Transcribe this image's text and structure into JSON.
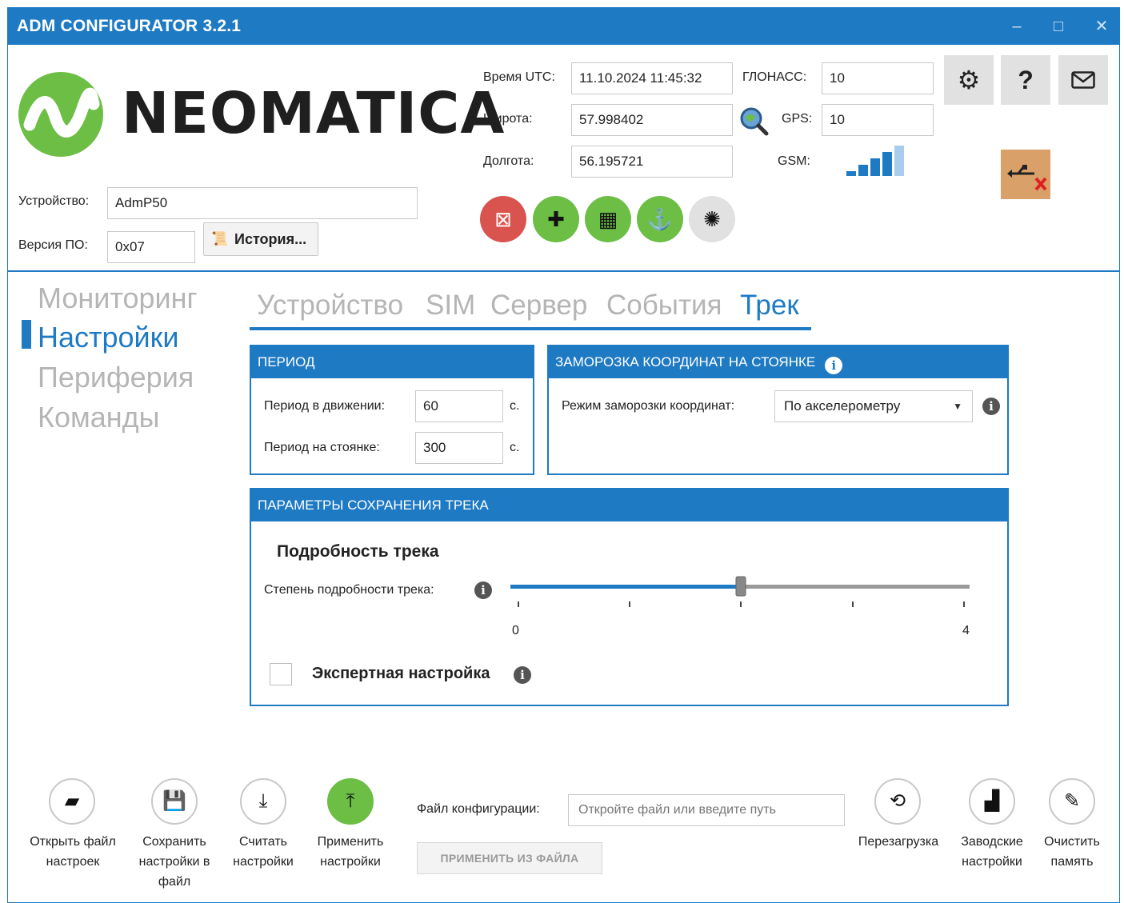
{
  "window": {
    "title": "ADM CONFIGURATOR 3.2.1",
    "controls": [
      "‒",
      "□",
      "✕"
    ]
  },
  "logo": {
    "text": "NEOMATICA"
  },
  "device": {
    "device_label": "Устройство:",
    "device_value": "AdmP50",
    "firmware_label": "Версия ПО:",
    "firmware_value": "0x07",
    "history_button": "История..."
  },
  "status": {
    "utc_label": "Время UTC:",
    "utc_value": "11.10.2024 11:45:32",
    "lat_label": "Широта:",
    "lat_value": "57.998402",
    "lon_label": "Долгота:",
    "lon_value": "56.195721",
    "glonass_label": "ГЛОНАСС:",
    "glonass_value": "10",
    "gps_label": "GPS:",
    "gps_value": "10",
    "gsm_label": "GSM:",
    "gsm_level": 4
  },
  "status_icons": [
    {
      "name": "no-connection-icon",
      "color": "#d9534f",
      "glyph": "⊠"
    },
    {
      "name": "power-plug-icon",
      "color": "#6cbe45",
      "glyph": "✚"
    },
    {
      "name": "map-icon",
      "color": "#6cbe45",
      "glyph": "▦"
    },
    {
      "name": "anchor-icon",
      "color": "#6cbe45",
      "glyph": "⚓"
    },
    {
      "name": "alarm-light-icon",
      "color": "#e1e1e1",
      "glyph": "✺"
    }
  ],
  "sidebar": {
    "items": [
      "Мониторинг",
      "Настройки",
      "Периферия",
      "Команды"
    ],
    "active": "Настройки"
  },
  "tabs": {
    "items": [
      "Устройство",
      "SIM",
      "Сервер",
      "События",
      "Трек"
    ],
    "active": "Трек"
  },
  "period": {
    "title": "ПЕРИОД",
    "moving_label": "Период в движении:",
    "moving_value": "60",
    "moving_unit": "с.",
    "parking_label": "Период на стоянке:",
    "parking_value": "300",
    "parking_unit": "с."
  },
  "freeze": {
    "title": "ЗАМОРОЗКА КООРДИНАТ НА СТОЯНКЕ",
    "mode_label": "Режим заморозки координат:",
    "mode_value": "По акселерометру"
  },
  "track": {
    "title": "ПАРАМЕТРЫ СОХРАНЕНИЯ ТРЕКА",
    "subtitle": "Подробность трека",
    "detail_label": "Степень подробности трека:",
    "slider_min": "0",
    "slider_max": "4",
    "slider_value": 2,
    "expert_label": "Экспертная настройка",
    "expert_checked": false
  },
  "footer": {
    "open_label_1": "Открыть файл",
    "open_label_2": "настроек",
    "save_label_1": "Сохранить",
    "save_label_2": "настройки в",
    "save_label_3": "файл",
    "read_label_1": "Считать",
    "read_label_2": "настройки",
    "apply_label_1": "Применить",
    "apply_label_2": "настройки",
    "config_file_label": "Файл конфигурации:",
    "config_file_placeholder": "Откройте файл или введите путь",
    "apply_from_file": "ПРИМЕНИТЬ ИЗ ФАЙЛА",
    "reboot_label": "Перезагрузка",
    "factory_label_1": "Заводские",
    "factory_label_2": "настройки",
    "clear_label_1": "Очистить",
    "clear_label_2": "память"
  },
  "colors": {
    "accent": "#1f7ac4",
    "green": "#6cbe45",
    "red": "#d9534f",
    "usb": "#d9a06a"
  }
}
